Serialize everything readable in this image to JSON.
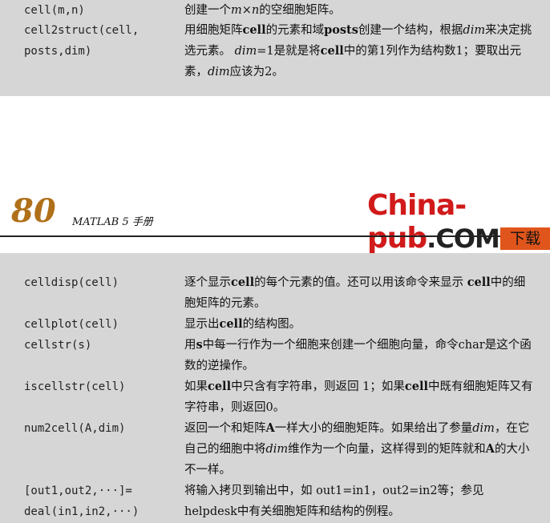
{
  "top_section": {
    "rows": [
      {
        "cmd": "cell(m,n)",
        "desc_html": "创建一个<i>m</i>×<i>n</i>的空细胞矩阵。"
      },
      {
        "cmd": "cell2struct(cell,\nposts,dim)",
        "desc_html": "用细胞矩阵<b>cell</b>的元素和域<b>posts</b>创建一个结构，根据<i>dim</i>来决定挑选元素。 <i>dim</i>=1是就是将<b>cell</b>中的第1列作为结构数1；要取出元素，<i>dim</i>应该为2。"
      }
    ]
  },
  "header": {
    "page_number": "80",
    "book_title": "MATLAB 5 手册",
    "logo_red": "China-pub",
    "logo_dark": ".COM",
    "download_label": "下载"
  },
  "bottom_section": {
    "rows": [
      {
        "cmd": "celldisp(cell)",
        "desc_html": "逐个显示<b>cell</b>的每个元素的值。还可以用该命令来显示 <b>cell</b>中的细胞矩阵的元素。"
      },
      {
        "cmd": "cellplot(cell)",
        "desc_html": "显示出<b>cell</b>的结构图。"
      },
      {
        "cmd": "cellstr(s)",
        "desc_html": "用<b>s</b>中每一行作为一个细胞来创建一个细胞向量，命令char是这个函数的逆操作。"
      },
      {
        "cmd": "iscellstr(cell)",
        "desc_html": "如果<b>cell</b>中只含有字符串，则返回 1；如果<b>cell</b>中既有细胞矩阵又有字符串，则返回0。"
      },
      {
        "cmd": "num2cell(A,dim)",
        "desc_html": "返回一个和矩阵<b>A</b>一样大小的细胞矩阵。如果给出了参量<i>dim</i>，在它自己的细胞中将<i>dim</i>维作为一个向量，这样得到的矩阵就和<b>A</b>的大小不一样。"
      },
      {
        "cmd": "[out1,out2,···]=\ndeal(in1,in2,···)",
        "desc_html": "将输入拷贝到输出中，如 out1=in1，out2=in2等；参见helpdesk中有关细胞矩阵和结构的例程。"
      }
    ]
  }
}
